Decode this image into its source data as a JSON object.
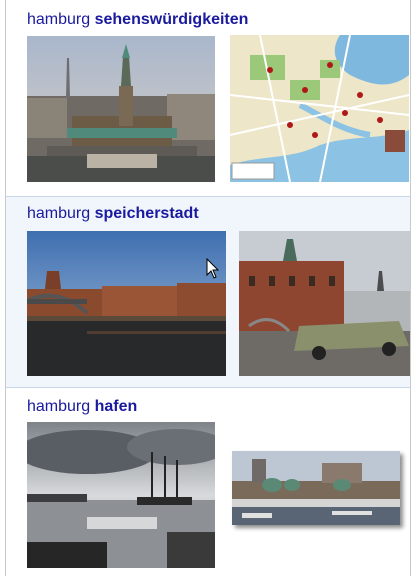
{
  "results": [
    {
      "query": "hamburg",
      "keyword": "sehenswürdigkeiten",
      "images": [
        {
          "subject": "Hamburg Rathaus aerial view"
        },
        {
          "subject": "Hamburg sightseeing map"
        }
      ]
    },
    {
      "query": "hamburg",
      "keyword": "speicherstadt",
      "images": [
        {
          "subject": "Speicherstadt canal and bridge"
        },
        {
          "subject": "Speicherstadt warehouse with vintage car"
        }
      ]
    },
    {
      "query": "hamburg",
      "keyword": "hafen",
      "images": [
        {
          "subject": "Hamburg harbour with sailing ship"
        },
        {
          "subject": "Landungsbrücken harbour view"
        }
      ]
    }
  ],
  "icons": {
    "cursor": "mouse-pointer-icon"
  },
  "colors": {
    "link": "#1a1a9e",
    "highlight_bg": "#f1f6fd",
    "border": "#c9c9c9"
  }
}
